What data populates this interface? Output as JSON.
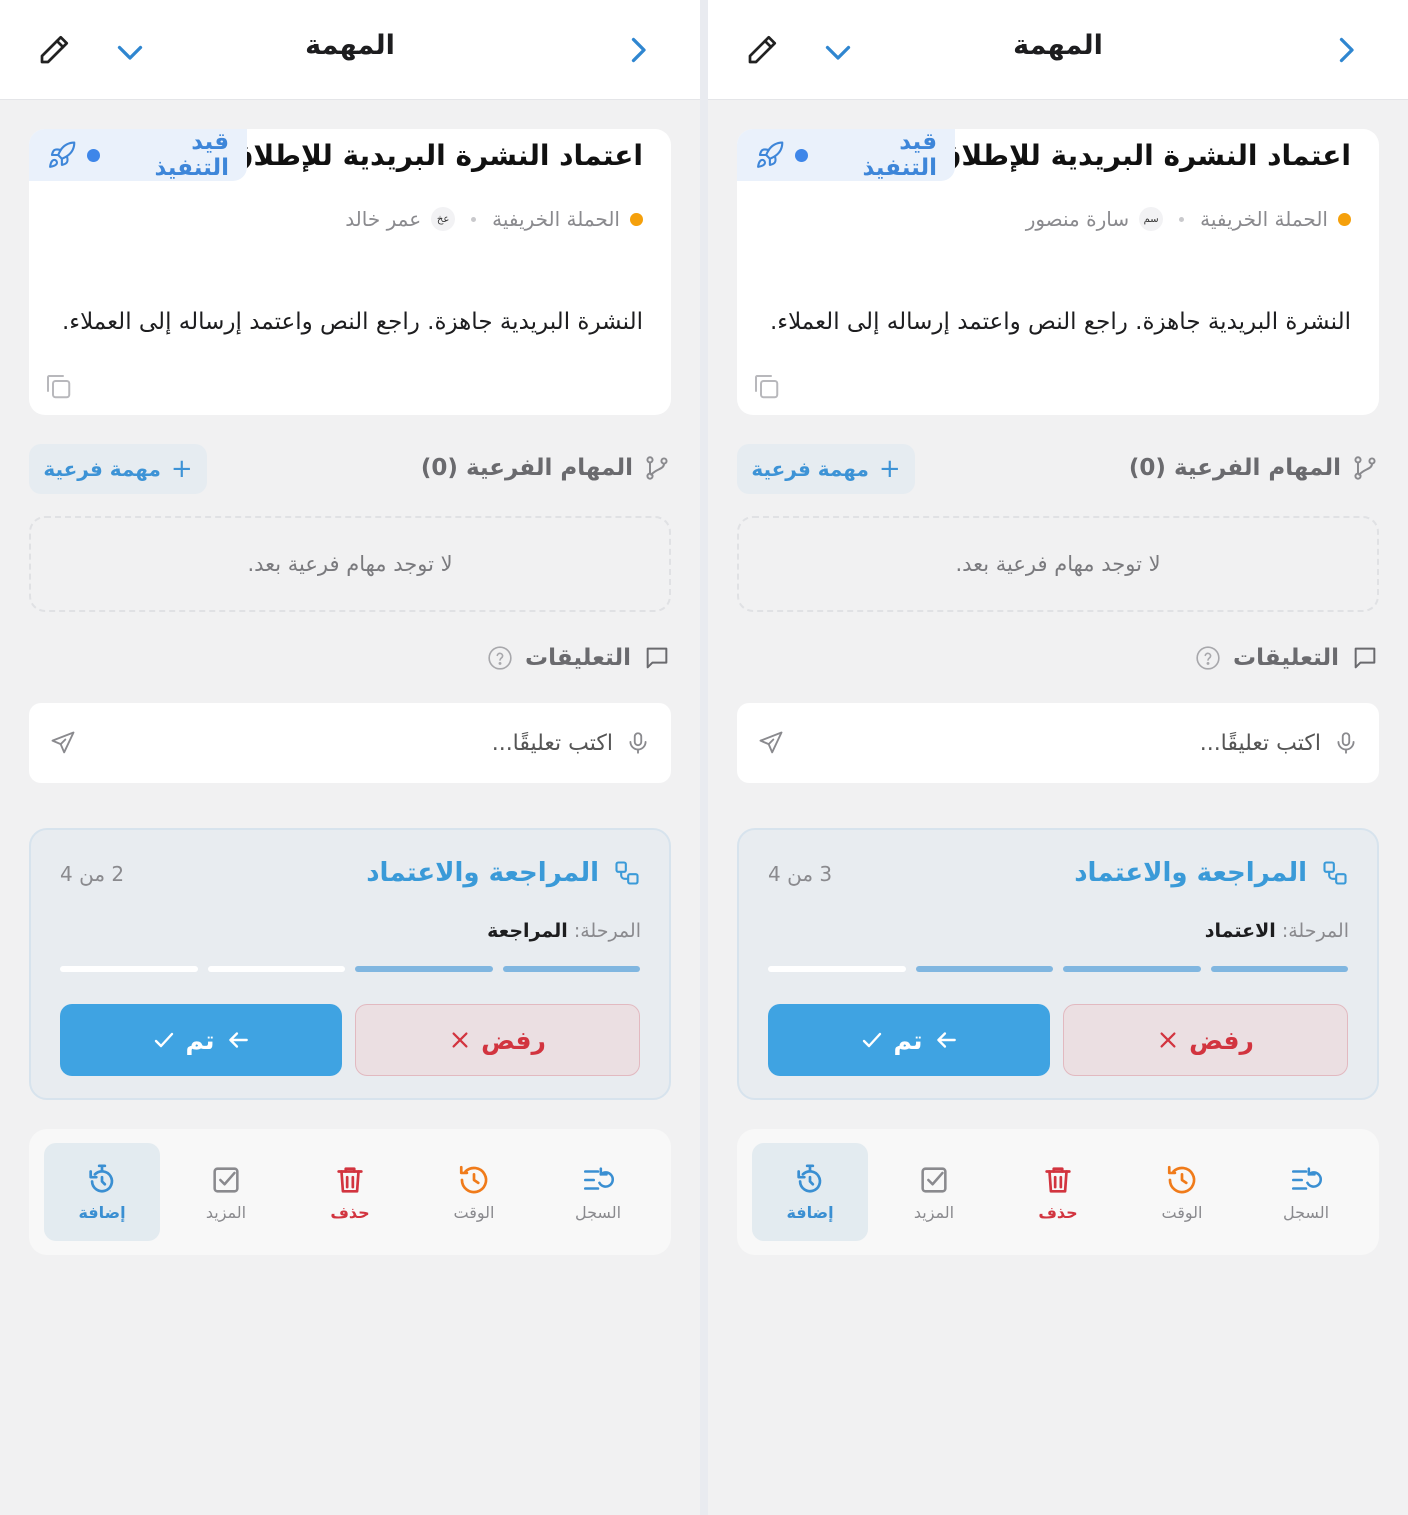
{
  "colors": {
    "accent": "#3fa3e2",
    "status_blue": "#3e86e9",
    "project_orange": "#f5a00b",
    "reject_red": "#d2343f",
    "time_orange": "#f07b1a"
  },
  "panels": [
    {
      "header": {
        "title": "المهمة"
      },
      "task": {
        "title": "اعتماد النشرة البريدية للإطلاق",
        "status": "قيد التنفيذ",
        "project": "الحملة الخريفية",
        "assignee_initials": "عخ",
        "assignee": "عمر خالد",
        "description": "النشرة البريدية جاهزة. راجع النص واعتمد إرساله إلى العملاء."
      },
      "subtasks": {
        "label": "المهام الفرعية (0)",
        "add_label": "مهمة فرعية",
        "empty": "لا توجد مهام فرعية بعد."
      },
      "comments": {
        "label": "التعليقات",
        "placeholder": "اكتب تعليقًا..."
      },
      "workflow": {
        "title": "المراجعة والاعتماد",
        "step_text": "2 من 4",
        "stage_label": "المرحلة:",
        "stage": "المراجعة",
        "progress": [
          true,
          true,
          false,
          false
        ],
        "reject_label": "رفض",
        "done_label": "تم"
      },
      "toolbar": {
        "log": "السجل",
        "time": "الوقت",
        "delete": "حذف",
        "more": "المزيد",
        "add": "إضافة"
      }
    },
    {
      "header": {
        "title": "المهمة"
      },
      "task": {
        "title": "اعتماد النشرة البريدية للإطلاق",
        "status": "قيد التنفيذ",
        "project": "الحملة الخريفية",
        "assignee_initials": "سم",
        "assignee": "سارة منصور",
        "description": "النشرة البريدية جاهزة. راجع النص واعتمد إرساله إلى العملاء."
      },
      "subtasks": {
        "label": "المهام الفرعية (0)",
        "add_label": "مهمة فرعية",
        "empty": "لا توجد مهام فرعية بعد."
      },
      "comments": {
        "label": "التعليقات",
        "placeholder": "اكتب تعليقًا..."
      },
      "workflow": {
        "title": "المراجعة والاعتماد",
        "step_text": "3 من 4",
        "stage_label": "المرحلة:",
        "stage": "الاعتماد",
        "progress": [
          true,
          true,
          true,
          false
        ],
        "reject_label": "رفض",
        "done_label": "تم"
      },
      "toolbar": {
        "log": "السجل",
        "time": "الوقت",
        "delete": "حذف",
        "more": "المزيد",
        "add": "إضافة"
      }
    }
  ]
}
